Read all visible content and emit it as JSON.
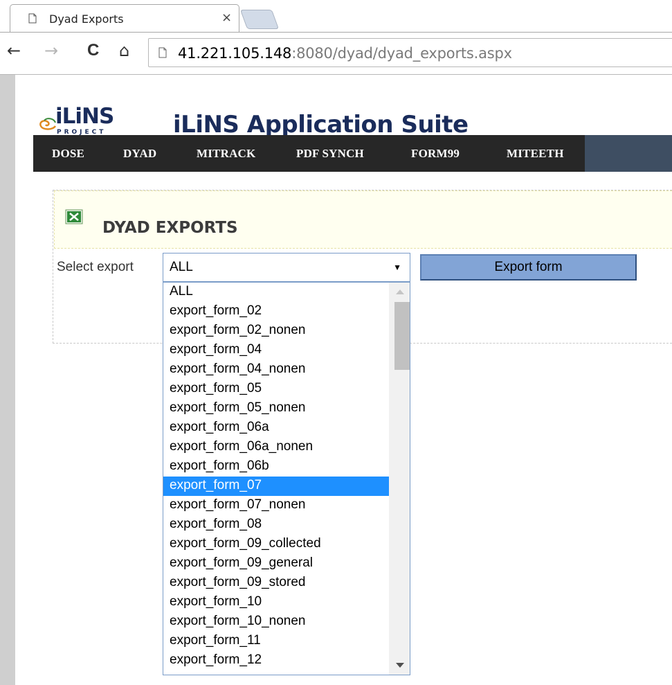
{
  "browser": {
    "tab_title": "Dyad Exports",
    "tab_close": "×",
    "back_glyph": "←",
    "forward_glyph": "→",
    "reload_glyph": "C",
    "home_glyph": "⌂",
    "url_host": "41.221.105.148",
    "url_rest": ":8080/dyad/dyad_exports.aspx"
  },
  "header": {
    "logo_text": "iLiNS",
    "logo_sub": "PROJECT",
    "site_title": "iLiNS Application Suite"
  },
  "menu": {
    "items": [
      "DOSE",
      "DYAD",
      "MITRACK",
      "PDF SYNCH",
      "FORM99",
      "MITEETH"
    ]
  },
  "panel": {
    "title": "DYAD EXPORTS",
    "select_label": "Select export",
    "selected_value": "ALL",
    "export_button": "Export form"
  },
  "dropdown": {
    "selected_index": 10,
    "options": [
      "ALL",
      "export_form_02",
      "export_form_02_nonen",
      "export_form_04",
      "export_form_04_nonen",
      "export_form_05",
      "export_form_05_nonen",
      "export_form_06a",
      "export_form_06a_nonen",
      "export_form_06b",
      "export_form_07",
      "export_form_07_nonen",
      "export_form_08",
      "export_form_09_collected",
      "export_form_09_general",
      "export_form_09_stored",
      "export_form_10",
      "export_form_10_nonen",
      "export_form_11",
      "export_form_12"
    ]
  },
  "colors": {
    "menu_bg": "#272727",
    "menu_bg_right": "#3e4e62",
    "title_color": "#1a2c5b",
    "selected_option": "#1e90ff",
    "button_bg": "#82a4d6"
  }
}
